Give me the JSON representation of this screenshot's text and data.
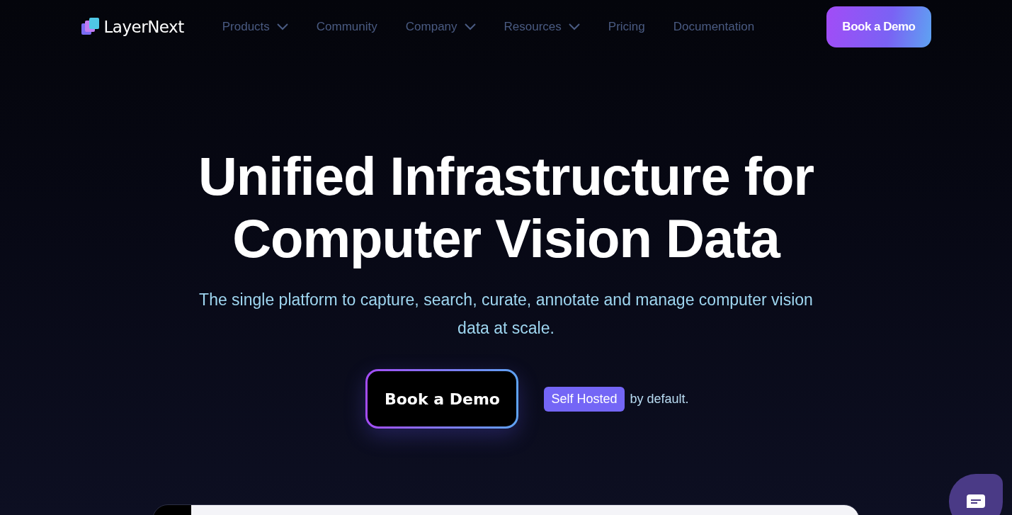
{
  "logo": {
    "name": "LayerNext"
  },
  "nav": [
    {
      "label": "Products",
      "has_menu": true
    },
    {
      "label": "Community",
      "has_menu": false
    },
    {
      "label": "Company",
      "has_menu": true
    },
    {
      "label": "Resources",
      "has_menu": true
    },
    {
      "label": "Pricing",
      "has_menu": false
    },
    {
      "label": "Documentation",
      "has_menu": false
    }
  ],
  "nav_button": "Book a Demo",
  "hero": {
    "title_lines": [
      "Unified Infrastructure for",
      "Computer Vision Data"
    ],
    "subtitle": "The single platform to capture, search, curate, annotate and manage computer vision data at scale.",
    "cta": "Book a Demo",
    "badge": "Self Hosted",
    "badge_note": "by default."
  }
}
